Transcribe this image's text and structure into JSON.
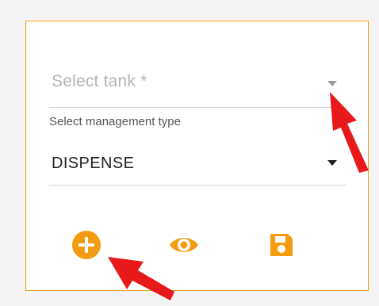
{
  "form": {
    "tank_placeholder": "Select tank *",
    "management_label": "Select management type",
    "management_value": "DISPENSE"
  },
  "actions": [
    {
      "icon": "add-circle-icon"
    },
    {
      "icon": "eye-icon"
    },
    {
      "icon": "floppy-disk-icon"
    }
  ],
  "colors": {
    "accent": "#f39c12",
    "annotation_arrow": "#e8191a",
    "divider": "#d7d7d7",
    "placeholder_text": "#b4b4b4"
  }
}
